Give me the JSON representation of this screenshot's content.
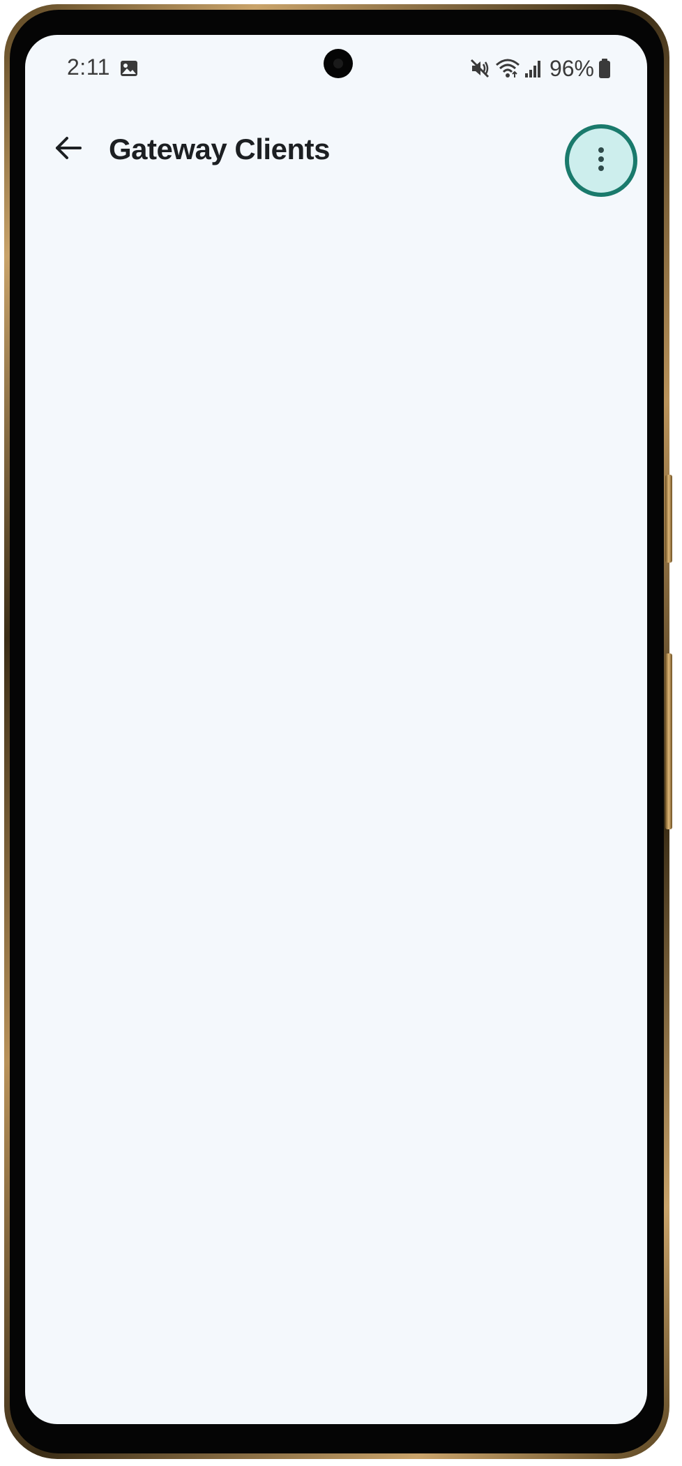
{
  "status_bar": {
    "time": "2:11",
    "battery_percent": "96%",
    "icons": [
      "gallery-icon",
      "mute-icon",
      "wifi-icon",
      "signal-icon",
      "battery-icon"
    ]
  },
  "app_bar": {
    "title": "Gateway Clients",
    "back_icon": "back-arrow-icon",
    "menu_icon": "more-vert-icon"
  },
  "colors": {
    "screen_background": "#f4f8fc",
    "highlight_fill": "#cdeeed",
    "highlight_ring": "#1a7a6c",
    "title_text": "#1c1f22"
  }
}
